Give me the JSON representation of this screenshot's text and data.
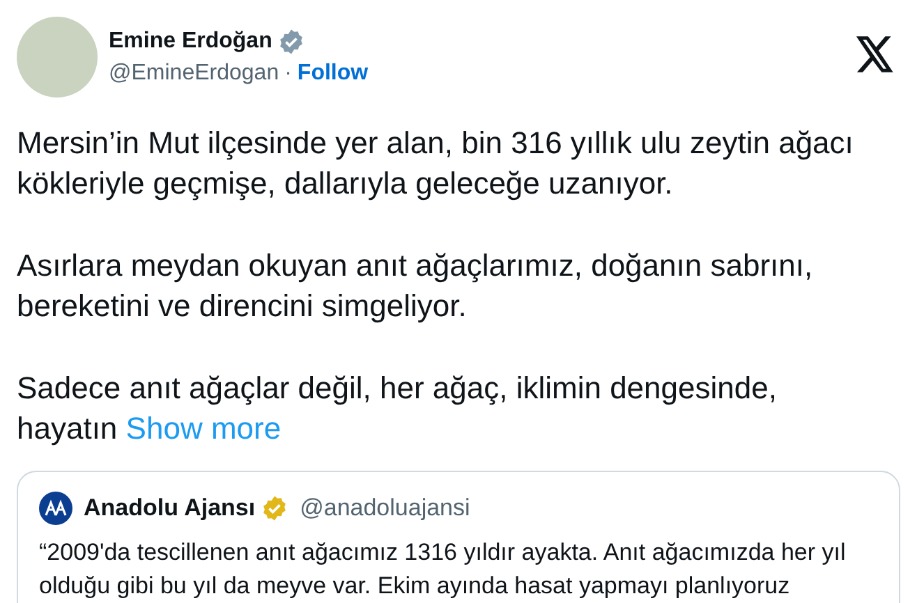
{
  "author": {
    "name": "Emine Erdoğan",
    "verified": true,
    "handle": "@EmineErdogan",
    "separator": "·",
    "follow": "Follow"
  },
  "paragraphs": [
    "Mersin’in Mut ilçesinde yer alan, bin 316 yıllık ulu zeytin ağacı kökleriyle geçmişe, dallarıyla geleceğe uzanıyor.",
    "Asırlara meydan okuyan anıt ağaçlarımız, doğanın sabrını, bereketini ve direncini simgeliyor.",
    "Sadece anıt ağaçlar değil, her ağaç, iklimin dengesinde, hayatın"
  ],
  "show_more": "Show more",
  "quote": {
    "name": "Anadolu Ajansı",
    "verified": true,
    "handle": "@anadoluajansi",
    "text": "“2009'da tescillenen anıt ağacımız 1316 yıldır ayakta. Anıt ağacımızda her yıl olduğu gibi bu yıl da meyve var. Ekim ayında hasat yapmayı planlıyoruz"
  }
}
